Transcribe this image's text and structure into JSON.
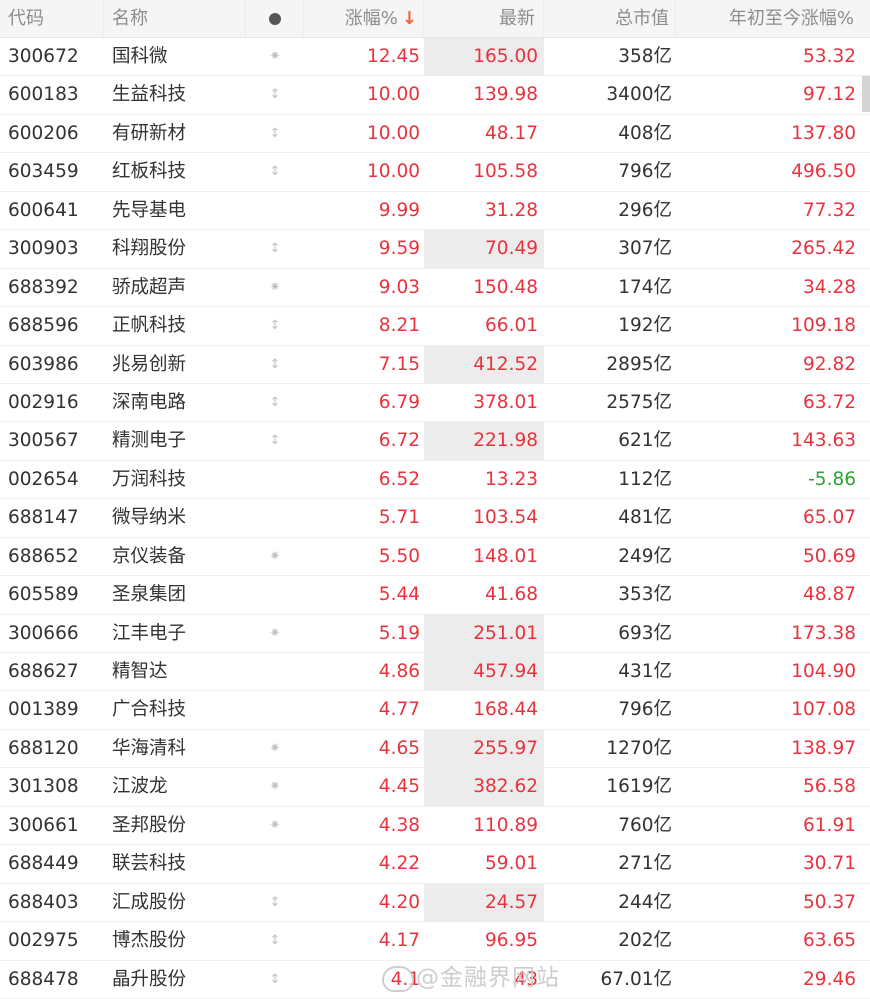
{
  "header": {
    "code": "代码",
    "name": "名称",
    "change": "涨幅%",
    "change_sort_arrow": "↓",
    "last": "最新",
    "mcap": "总市值",
    "ytd": "年初至今涨幅%"
  },
  "rows": [
    {
      "code": "300672",
      "name": "国科微",
      "icon": "✷",
      "change": "12.45",
      "last": "165.00",
      "mcap": "358亿",
      "ytd": "53.32"
    },
    {
      "code": "600183",
      "name": "生益科技",
      "icon": "↕",
      "change": "10.00",
      "last": "139.98",
      "mcap": "3400亿",
      "ytd": "97.12"
    },
    {
      "code": "600206",
      "name": "有研新材",
      "icon": "↕",
      "change": "10.00",
      "last": "48.17",
      "mcap": "408亿",
      "ytd": "137.80"
    },
    {
      "code": "603459",
      "name": "红板科技",
      "icon": "↕",
      "change": "10.00",
      "last": "105.58",
      "mcap": "796亿",
      "ytd": "496.50"
    },
    {
      "code": "600641",
      "name": "先导基电",
      "icon": "",
      "change": "9.99",
      "last": "31.28",
      "mcap": "296亿",
      "ytd": "77.32"
    },
    {
      "code": "300903",
      "name": "科翔股份",
      "icon": "↕",
      "change": "9.59",
      "last": "70.49",
      "mcap": "307亿",
      "ytd": "265.42"
    },
    {
      "code": "688392",
      "name": "骄成超声",
      "icon": "✷",
      "change": "9.03",
      "last": "150.48",
      "mcap": "174亿",
      "ytd": "34.28"
    },
    {
      "code": "688596",
      "name": "正帆科技",
      "icon": "↕",
      "change": "8.21",
      "last": "66.01",
      "mcap": "192亿",
      "ytd": "109.18"
    },
    {
      "code": "603986",
      "name": "兆易创新",
      "icon": "↕",
      "change": "7.15",
      "last": "412.52",
      "mcap": "2895亿",
      "ytd": "92.82"
    },
    {
      "code": "002916",
      "name": "深南电路",
      "icon": "↕",
      "change": "6.79",
      "last": "378.01",
      "mcap": "2575亿",
      "ytd": "63.72"
    },
    {
      "code": "300567",
      "name": "精测电子",
      "icon": "↕",
      "change": "6.72",
      "last": "221.98",
      "mcap": "621亿",
      "ytd": "143.63"
    },
    {
      "code": "002654",
      "name": "万润科技",
      "icon": "",
      "change": "6.52",
      "last": "13.23",
      "mcap": "112亿",
      "ytd": "-5.86"
    },
    {
      "code": "688147",
      "name": "微导纳米",
      "icon": "",
      "change": "5.71",
      "last": "103.54",
      "mcap": "481亿",
      "ytd": "65.07"
    },
    {
      "code": "688652",
      "name": "京仪装备",
      "icon": "✷",
      "change": "5.50",
      "last": "148.01",
      "mcap": "249亿",
      "ytd": "50.69"
    },
    {
      "code": "605589",
      "name": "圣泉集团",
      "icon": "",
      "change": "5.44",
      "last": "41.68",
      "mcap": "353亿",
      "ytd": "48.87"
    },
    {
      "code": "300666",
      "name": "江丰电子",
      "icon": "✷",
      "change": "5.19",
      "last": "251.01",
      "mcap": "693亿",
      "ytd": "173.38"
    },
    {
      "code": "688627",
      "name": "精智达",
      "icon": "",
      "change": "4.86",
      "last": "457.94",
      "mcap": "431亿",
      "ytd": "104.90"
    },
    {
      "code": "001389",
      "name": "广合科技",
      "icon": "",
      "change": "4.77",
      "last": "168.44",
      "mcap": "796亿",
      "ytd": "107.08"
    },
    {
      "code": "688120",
      "name": "华海清科",
      "icon": "✷",
      "change": "4.65",
      "last": "255.97",
      "mcap": "1270亿",
      "ytd": "138.97"
    },
    {
      "code": "301308",
      "name": "江波龙",
      "icon": "✷",
      "change": "4.45",
      "last": "382.62",
      "mcap": "1619亿",
      "ytd": "56.58"
    },
    {
      "code": "300661",
      "name": "圣邦股份",
      "icon": "✷",
      "change": "4.38",
      "last": "110.89",
      "mcap": "760亿",
      "ytd": "61.91"
    },
    {
      "code": "688449",
      "name": "联芸科技",
      "icon": "",
      "change": "4.22",
      "last": "59.01",
      "mcap": "271亿",
      "ytd": "30.71"
    },
    {
      "code": "688403",
      "name": "汇成股份",
      "icon": "↕",
      "change": "4.20",
      "last": "24.57",
      "mcap": "244亿",
      "ytd": "50.37"
    },
    {
      "code": "002975",
      "name": "博杰股份",
      "icon": "↕",
      "change": "4.17",
      "last": "96.95",
      "mcap": "202亿",
      "ytd": "63.65"
    },
    {
      "code": "688478",
      "name": "晶升股份",
      "icon": "↕",
      "change": "4.1",
      "last": "43",
      "mcap": "67.01亿",
      "ytd": "29.46"
    }
  ],
  "highlight_last_rows": [
    0,
    5,
    8,
    10,
    15,
    16,
    18,
    19,
    22
  ],
  "negative_ytd_rows": [
    11
  ],
  "colors": {
    "up": "#e8333f",
    "down": "#2fa238",
    "text": "#333333",
    "header_text": "#8d8d8d",
    "highlight": "#ececec"
  },
  "watermark": {
    "text": "@金融界网站",
    "icon": "weibo-icon"
  }
}
